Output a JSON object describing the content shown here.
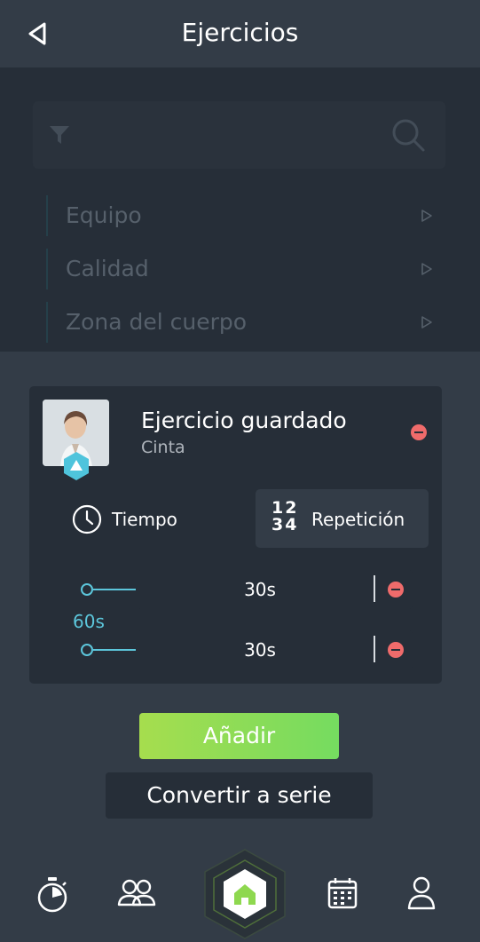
{
  "header": {
    "title": "Ejercicios",
    "back_icon": "back-arrow-icon"
  },
  "filters": {
    "filter_icon": "funnel-icon",
    "search_icon": "search-icon",
    "items": [
      {
        "label": "Equipo"
      },
      {
        "label": "Calidad"
      },
      {
        "label": "Zona del cuerpo"
      }
    ]
  },
  "exercise": {
    "title": "Ejercicio guardado",
    "subtitle": "Cinta",
    "modes": {
      "time": "Tiempo",
      "repetition": "Repetición",
      "rep_icon_digits": "12\n34"
    },
    "intervals": [
      {
        "value": "30s"
      },
      {
        "value": "30s"
      }
    ],
    "total": "60s"
  },
  "actions": {
    "add": "Añadir",
    "convert": "Convertir a serie"
  },
  "nav": {
    "items": [
      "stopwatch-icon",
      "group-icon",
      "home-icon",
      "calendar-icon",
      "profile-icon"
    ],
    "active": "home"
  },
  "colors": {
    "background": "#333c47",
    "panel": "#262e38",
    "accent_cyan": "#5cc6db",
    "remove_red": "#ef6b6b",
    "add_green_start": "#a6dd4e",
    "add_green_end": "#75dc60"
  }
}
